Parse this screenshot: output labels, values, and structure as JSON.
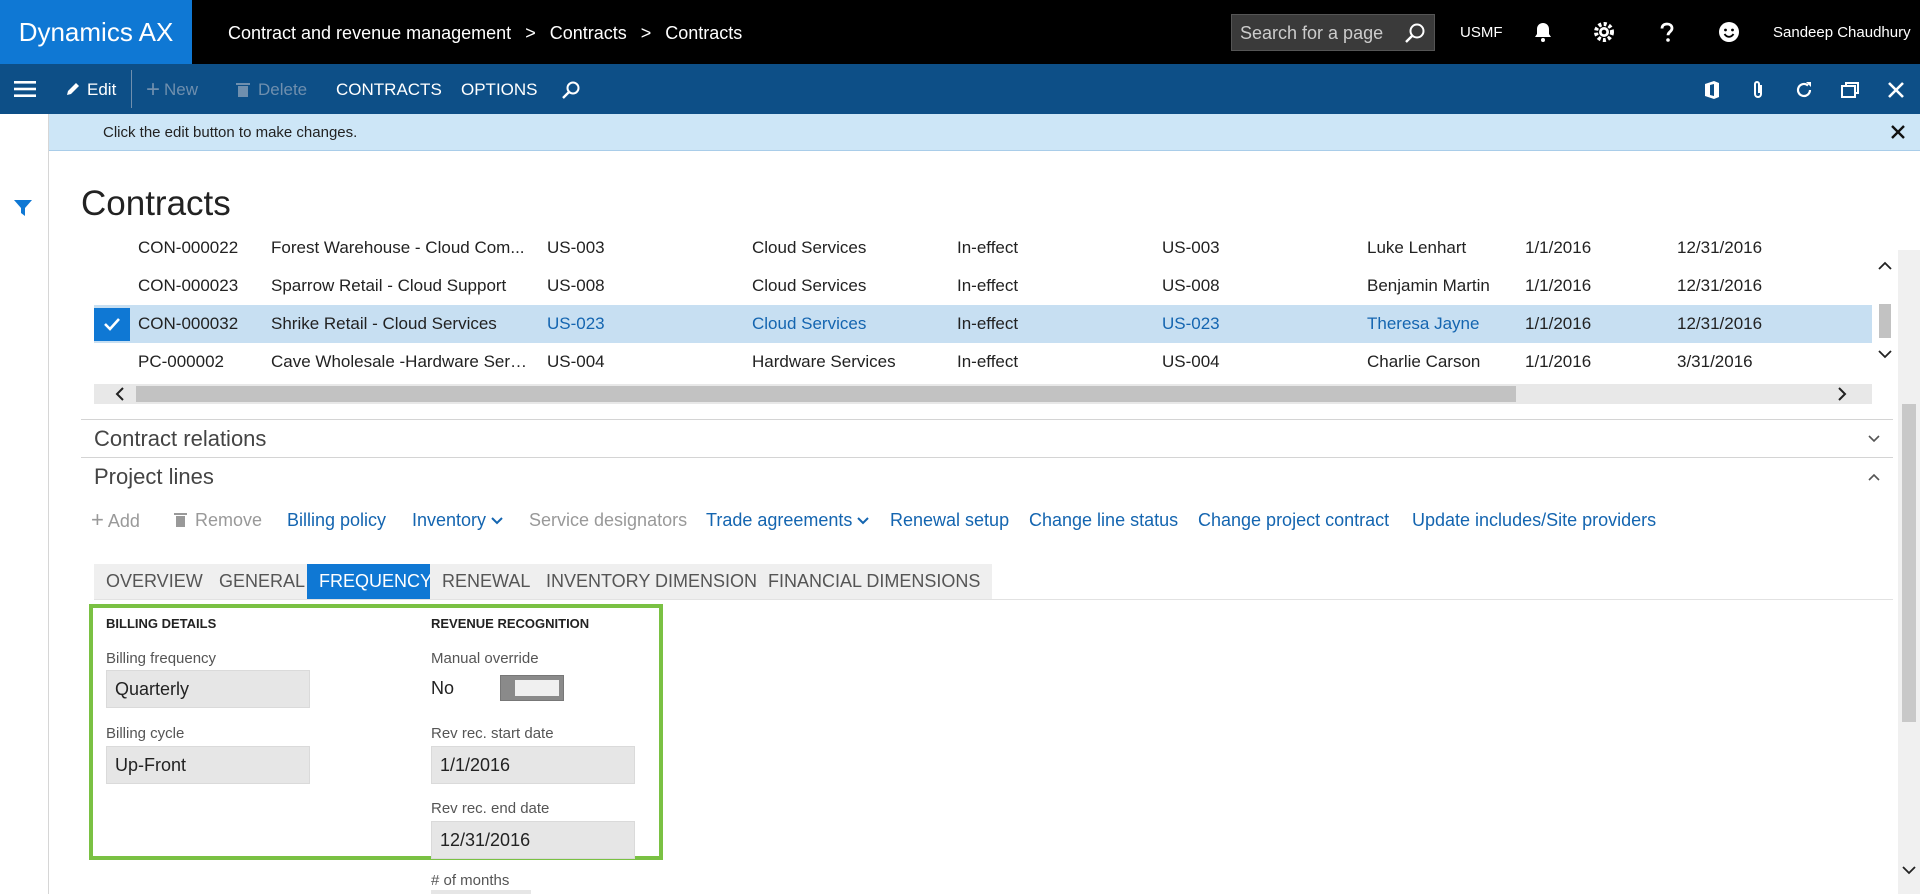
{
  "app": {
    "brand": "Dynamics AX"
  },
  "breadcrumb": [
    "Contract and revenue management",
    "Contracts",
    "Contracts"
  ],
  "search": {
    "placeholder": "Search for a page"
  },
  "company": "USMF",
  "user": {
    "name": "Sandeep Chaudhury"
  },
  "actionbar": {
    "edit": "Edit",
    "new": "New",
    "delete": "Delete",
    "contracts": "CONTRACTS",
    "options": "OPTIONS"
  },
  "message": "Click the edit button to make changes.",
  "page_title": "Contracts",
  "grid": {
    "rows": [
      {
        "id": "CON-000022",
        "name": "Forest Warehouse - Cloud Com...",
        "customer": "US-003",
        "group": "Cloud Services",
        "status": "In-effect",
        "account": "US-003",
        "manager": "Luke Lenhart",
        "start": "1/1/2016",
        "end": "12/31/2016"
      },
      {
        "id": "CON-000023",
        "name": "Sparrow Retail - Cloud Support",
        "customer": "US-008",
        "group": "Cloud Services",
        "status": "In-effect",
        "account": "US-008",
        "manager": "Benjamin Martin",
        "start": "1/1/2016",
        "end": "12/31/2016"
      },
      {
        "id": "CON-000032",
        "name": "Shrike Retail - Cloud Services",
        "customer": "US-023",
        "group": "Cloud Services",
        "status": "In-effect",
        "account": "US-023",
        "manager": "Theresa Jayne",
        "start": "1/1/2016",
        "end": "12/31/2016"
      },
      {
        "id": "PC-000002",
        "name": "Cave Wholesale -Hardware Serv...",
        "customer": "US-004",
        "group": "Hardware Services",
        "status": "In-effect",
        "account": "US-004",
        "manager": "Charlie Carson",
        "start": "1/1/2016",
        "end": "3/31/2016"
      }
    ],
    "selected_index": 2
  },
  "sections": {
    "contract_relations": "Contract relations",
    "project_lines": "Project lines"
  },
  "line_tools": {
    "add": "Add",
    "remove": "Remove",
    "billing_policy": "Billing policy",
    "inventory": "Inventory",
    "service_designators": "Service designators",
    "trade_agreements": "Trade agreements",
    "renewal_setup": "Renewal setup",
    "change_line_status": "Change line status",
    "change_project_contract": "Change project contract",
    "update_includes": "Update includes/Site providers"
  },
  "tabs": [
    "OVERVIEW",
    "GENERAL",
    "FREQUENCY",
    "RENEWAL",
    "INVENTORY DIMENSION",
    "FINANCIAL DIMENSIONS"
  ],
  "active_tab": "FREQUENCY",
  "billing": {
    "title": "BILLING DETAILS",
    "frequency_label": "Billing frequency",
    "frequency_value": "Quarterly",
    "cycle_label": "Billing cycle",
    "cycle_value": "Up-Front"
  },
  "revenue": {
    "title": "REVENUE RECOGNITION",
    "override_label": "Manual override",
    "override_value": "No",
    "start_label": "Rev rec. start date",
    "start_value": "1/1/2016",
    "end_label": "Rev rec. end date",
    "end_value": "12/31/2016",
    "months_label": "# of months"
  },
  "colors": {
    "brand": "#0f78d4",
    "actionbar": "#0d4f87",
    "highlight": "#7ac143",
    "link": "#1465b0"
  }
}
